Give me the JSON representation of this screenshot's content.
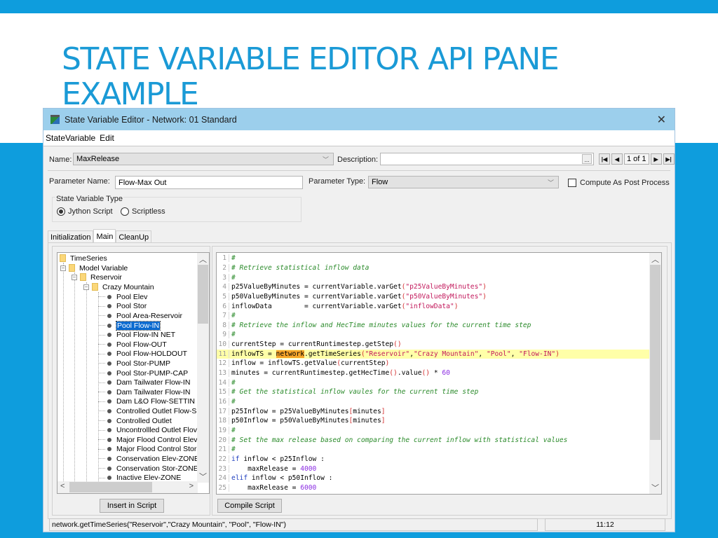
{
  "slide": {
    "title": "STATE VARIABLE EDITOR API PANE EXAMPLE",
    "accent_color": "#0e9ddd"
  },
  "window": {
    "title": "State Variable Editor - Network: 01 Standard",
    "close_icon": "close-icon",
    "menu": [
      "StateVariable",
      "Edit"
    ]
  },
  "form": {
    "name_label": "Name:",
    "name_value": "MaxRelease",
    "description_label": "Description:",
    "description_value": "",
    "ellipsis_label": "...",
    "page_indicator": "1 of 1",
    "nav_icons": [
      "first-page-icon",
      "prev-page-icon",
      "next-page-icon",
      "last-page-icon"
    ],
    "parameter_name_label": "Parameter Name:",
    "parameter_name_value": "Flow-Max Out",
    "parameter_type_label": "Parameter Type:",
    "parameter_type_value": "Flow",
    "compute_post_label": "Compute As Post Process",
    "compute_post_checked": false,
    "sv_type_label": "State Variable Type",
    "sv_type_options": [
      "Jython Script",
      "Scriptless"
    ],
    "sv_type_selected": "Jython Script"
  },
  "tabs": [
    "Initialization",
    "Main",
    "CleanUp"
  ],
  "active_tab": "Main",
  "tree": {
    "root": "TimeSeries",
    "model_variable": "Model Variable",
    "reservoir": "Reservoir",
    "crazy_mountain": "Crazy Mountain",
    "leaves": [
      "Pool Elev",
      "Pool Stor",
      "Pool Area-Reservoir",
      "Pool Flow-IN",
      "Pool Flow-IN NET",
      "Pool Flow-OUT",
      "Pool Flow-HOLDOUT",
      "Pool Stor-PUMP",
      "Pool Stor-PUMP-CAP",
      "Dam Tailwater Flow-IN",
      "Dam Tailwater Flow-IN",
      "Dam L&O Flow-SETTIN",
      "Controlled Outlet Flow-S",
      "Controlled Outlet",
      "Uncontrollled Outlet Flov",
      "Major Flood Control Elev",
      "Major Flood Control Stor",
      "Conservation Elev-ZONE",
      "Conservation Stor-ZONE",
      "Inactive Elev-ZONE"
    ],
    "selected": "Pool Flow-IN"
  },
  "code": {
    "lines": [
      "#",
      "# Retrieve statistical inflow data",
      "#",
      "p25ValueByMinutes = currentVariable.varGet(\"p25ValueByMinutes\")",
      "p50ValueByMinutes = currentVariable.varGet(\"p50ValueByMinutes\")",
      "inflowData        = currentVariable.varGet(\"inflowData\")",
      "#",
      "# Retrieve the inflow and HecTime minutes values for the current time step",
      "#",
      "currentStep = currentRuntimestep.getStep()",
      "inflowTS = network.getTimeSeries(\"Reservoir\",\"Crazy Mountain\", \"Pool\", \"Flow-IN\")",
      "inflow = inflowTS.getValue(currentStep)",
      "minutes = currentRuntimestep.getHecTime().value() * 60",
      "#",
      "# Get the statistical inflow vaules for the current time step",
      "#",
      "p25Inflow = p25ValueByMinutes[minutes]",
      "p50Inflow = p50ValueByMinutes[minutes]",
      "#",
      "# Set the max release based on comparing the current inflow with statistical values",
      "#",
      "if inflow < p25Inflow :",
      "    maxRelease = 4000",
      "elif inflow < p50Inflow :",
      "    maxRelease = 6000"
    ],
    "highlighted_line": 11
  },
  "buttons": {
    "insert_script": "Insert in Script",
    "compile_script": "Compile Script"
  },
  "status": {
    "message": "network.getTimeSeries(\"Reservoir\",\"Crazy Mountain\", \"Pool\", \"Flow-IN\")",
    "position": "11:12"
  }
}
